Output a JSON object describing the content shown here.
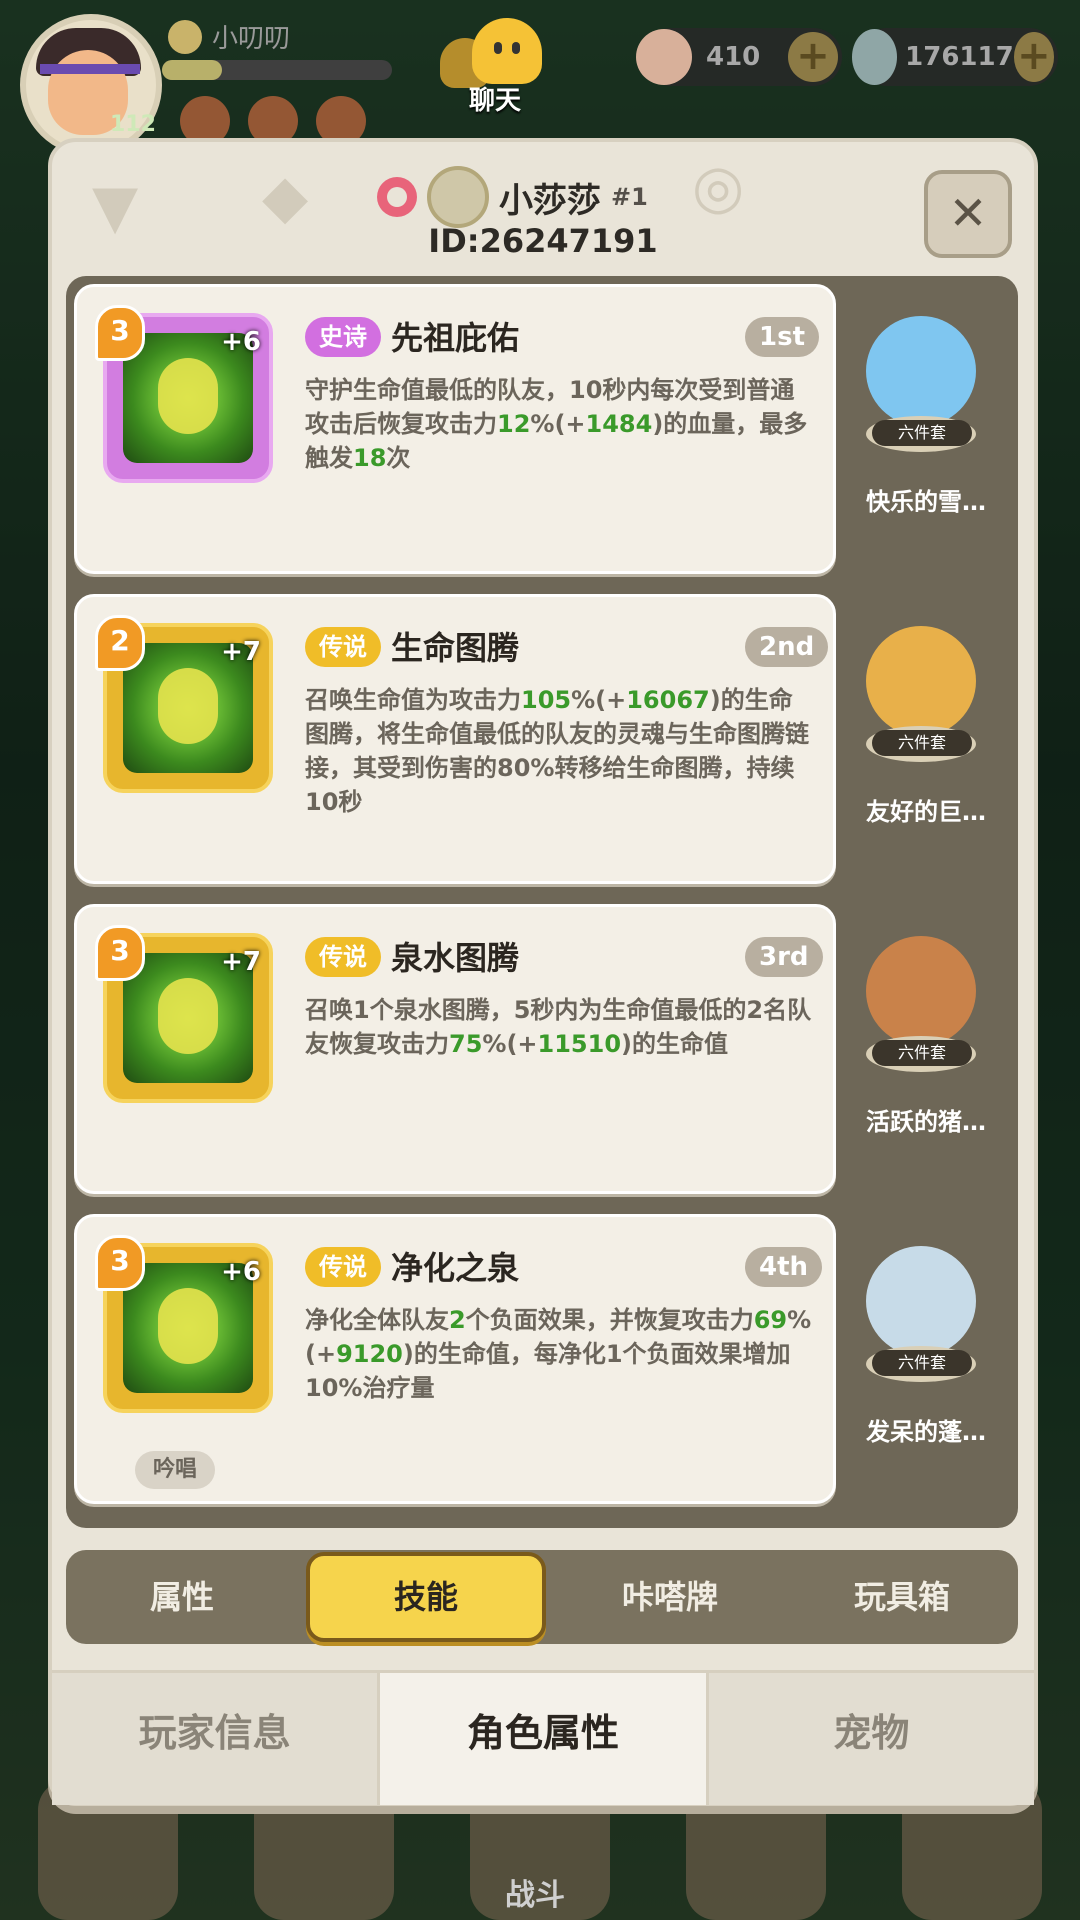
{
  "hud": {
    "player_name": "小叨叨",
    "level": "112",
    "chat_label": "聊天",
    "resource1": "410",
    "resource2": "176117",
    "battle_label": "战斗"
  },
  "panel": {
    "name": "小莎莎",
    "name_suffix": "#1",
    "id_text": "ID:26247191",
    "close_label": "✕"
  },
  "skills": [
    {
      "level": "3",
      "plus": "+6",
      "rarity": "史诗",
      "name": "先祖庇佑",
      "rank": "1st",
      "desc_parts": [
        "守护生命值最低的队友，10秒内每次受到普通攻击后恢复攻击力",
        "12",
        "%(+",
        "1484",
        ")的血量，最多触发",
        "18",
        "次"
      ],
      "pet_tag": "六件套",
      "pet_name": "快乐的雪…"
    },
    {
      "level": "2",
      "plus": "+7",
      "rarity": "传说",
      "name": "生命图腾",
      "rank": "2nd",
      "desc_parts": [
        "召唤生命值为攻击力",
        "105",
        "%(+",
        "16067",
        ")的生命图腾，将生命值最低的队友的灵魂与生命图腾链接，其受到伤害的80%转移给生命图腾，持续10秒"
      ],
      "pet_tag": "六件套",
      "pet_name": "友好的巨…"
    },
    {
      "level": "3",
      "plus": "+7",
      "rarity": "传说",
      "name": "泉水图腾",
      "rank": "3rd",
      "desc_parts": [
        "召唤1个泉水图腾，5秒内为生命值最低的2名队友恢复攻击力",
        "75",
        "%(+",
        "11510",
        ")的生命值"
      ],
      "pet_tag": "六件套",
      "pet_name": "活跃的猪…"
    },
    {
      "level": "3",
      "plus": "+6",
      "rarity": "传说",
      "name": "净化之泉",
      "rank": "4th",
      "desc_parts": [
        "净化全体队友",
        "2",
        "个负面效果，并恢复攻击力",
        "69",
        "%(+",
        "9120",
        ")的生命值，每净化1个负面效果增加10%治疗量"
      ],
      "chant": "吟唱",
      "pet_tag": "六件套",
      "pet_name": "发呆的蓬…"
    }
  ],
  "subtabs": [
    "属性",
    "技能",
    "咔嗒牌",
    "玩具箱"
  ],
  "maintabs": [
    "玩家信息",
    "角色属性",
    "宠物"
  ],
  "colors": {
    "epic": "#d26fe0",
    "legend": "#f0bd28",
    "highlight_green": "#3a9a2a",
    "active_tab": "#f6d44c"
  }
}
